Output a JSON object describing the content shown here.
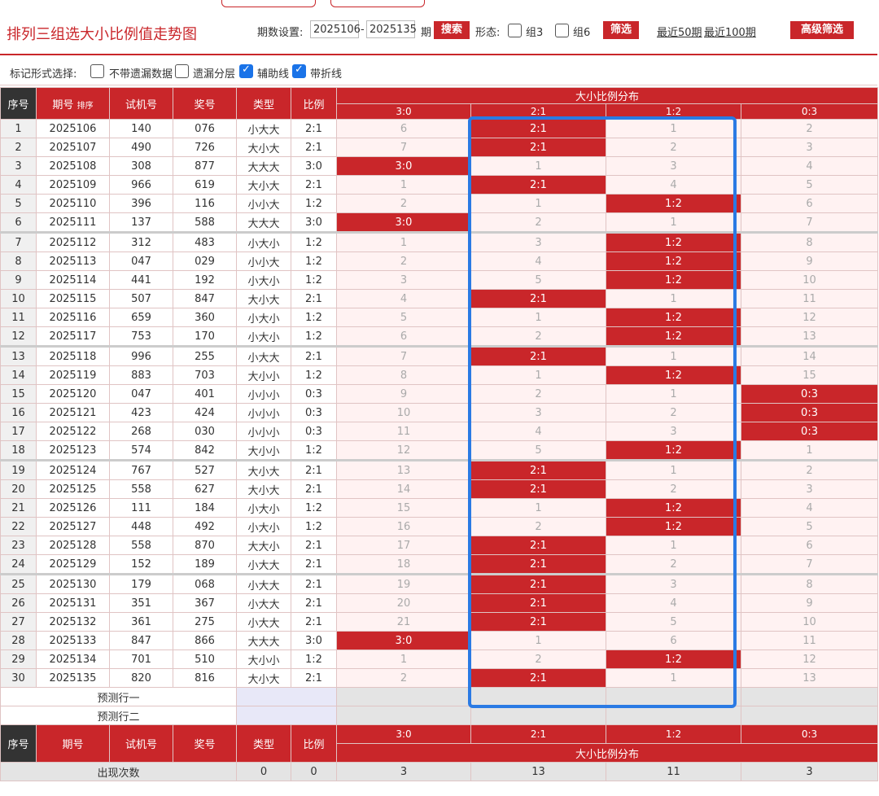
{
  "header": {
    "title": "排列三组选大小比例值走势图",
    "period_label": "期数设置:",
    "period_from": "2025106",
    "dash": "-",
    "period_to": "2025135",
    "period_unit": "期",
    "search_label": "搜索",
    "form_label": "形态:",
    "group3_label": "组3",
    "group6_label": "组6",
    "filter_label": "筛选",
    "recent50": "最近50期",
    "recent100": "最近100期",
    "advanced_label": "高级筛选"
  },
  "markrow": {
    "label": "标记形式选择:",
    "opt1": "不带遗漏数据",
    "opt2": "遗漏分层",
    "opt3": "辅助线",
    "opt4": "带折线"
  },
  "table": {
    "headers": {
      "seq": "序号",
      "period": "期号",
      "sort": "排序",
      "trial": "试机号",
      "draw": "奖号",
      "type": "类型",
      "ratio": "比例",
      "dist": "大小比例分布"
    },
    "ratio_cols": [
      "3:0",
      "2:1",
      "1:2",
      "0:3"
    ],
    "rows": [
      {
        "seq": "1",
        "period": "2025106",
        "trial": "140",
        "draw": "076",
        "type": "小大大",
        "ratio": "2:1",
        "d": [
          "6",
          "2:1",
          "1",
          "2"
        ],
        "hit": 1
      },
      {
        "seq": "2",
        "period": "2025107",
        "trial": "490",
        "draw": "726",
        "type": "大小大",
        "ratio": "2:1",
        "d": [
          "7",
          "2:1",
          "2",
          "3"
        ],
        "hit": 1
      },
      {
        "seq": "3",
        "period": "2025108",
        "trial": "308",
        "draw": "877",
        "type": "大大大",
        "ratio": "3:0",
        "d": [
          "3:0",
          "1",
          "3",
          "4"
        ],
        "hit": 0
      },
      {
        "seq": "4",
        "period": "2025109",
        "trial": "966",
        "draw": "619",
        "type": "大小大",
        "ratio": "2:1",
        "d": [
          "1",
          "2:1",
          "4",
          "5"
        ],
        "hit": 1
      },
      {
        "seq": "5",
        "period": "2025110",
        "trial": "396",
        "draw": "116",
        "type": "小小大",
        "ratio": "1:2",
        "d": [
          "2",
          "1",
          "1:2",
          "6"
        ],
        "hit": 2
      },
      {
        "seq": "6",
        "period": "2025111",
        "trial": "137",
        "draw": "588",
        "type": "大大大",
        "ratio": "3:0",
        "d": [
          "3:0",
          "2",
          "1",
          "7"
        ],
        "hit": 0
      },
      {
        "seq": "7",
        "period": "2025112",
        "trial": "312",
        "draw": "483",
        "type": "小大小",
        "ratio": "1:2",
        "d": [
          "1",
          "3",
          "1:2",
          "8"
        ],
        "hit": 2
      },
      {
        "seq": "8",
        "period": "2025113",
        "trial": "047",
        "draw": "029",
        "type": "小小大",
        "ratio": "1:2",
        "d": [
          "2",
          "4",
          "1:2",
          "9"
        ],
        "hit": 2
      },
      {
        "seq": "9",
        "period": "2025114",
        "trial": "441",
        "draw": "192",
        "type": "小大小",
        "ratio": "1:2",
        "d": [
          "3",
          "5",
          "1:2",
          "10"
        ],
        "hit": 2
      },
      {
        "seq": "10",
        "period": "2025115",
        "trial": "507",
        "draw": "847",
        "type": "大小大",
        "ratio": "2:1",
        "d": [
          "4",
          "2:1",
          "1",
          "11"
        ],
        "hit": 1
      },
      {
        "seq": "11",
        "period": "2025116",
        "trial": "659",
        "draw": "360",
        "type": "小大小",
        "ratio": "1:2",
        "d": [
          "5",
          "1",
          "1:2",
          "12"
        ],
        "hit": 2
      },
      {
        "seq": "12",
        "period": "2025117",
        "trial": "753",
        "draw": "170",
        "type": "小大小",
        "ratio": "1:2",
        "d": [
          "6",
          "2",
          "1:2",
          "13"
        ],
        "hit": 2
      },
      {
        "seq": "13",
        "period": "2025118",
        "trial": "996",
        "draw": "255",
        "type": "小大大",
        "ratio": "2:1",
        "d": [
          "7",
          "2:1",
          "1",
          "14"
        ],
        "hit": 1
      },
      {
        "seq": "14",
        "period": "2025119",
        "trial": "883",
        "draw": "703",
        "type": "大小小",
        "ratio": "1:2",
        "d": [
          "8",
          "1",
          "1:2",
          "15"
        ],
        "hit": 2
      },
      {
        "seq": "15",
        "period": "2025120",
        "trial": "047",
        "draw": "401",
        "type": "小小小",
        "ratio": "0:3",
        "d": [
          "9",
          "2",
          "1",
          "0:3"
        ],
        "hit": 3
      },
      {
        "seq": "16",
        "period": "2025121",
        "trial": "423",
        "draw": "424",
        "type": "小小小",
        "ratio": "0:3",
        "d": [
          "10",
          "3",
          "2",
          "0:3"
        ],
        "hit": 3
      },
      {
        "seq": "17",
        "period": "2025122",
        "trial": "268",
        "draw": "030",
        "type": "小小小",
        "ratio": "0:3",
        "d": [
          "11",
          "4",
          "3",
          "0:3"
        ],
        "hit": 3
      },
      {
        "seq": "18",
        "period": "2025123",
        "trial": "574",
        "draw": "842",
        "type": "大小小",
        "ratio": "1:2",
        "d": [
          "12",
          "5",
          "1:2",
          "1"
        ],
        "hit": 2
      },
      {
        "seq": "19",
        "period": "2025124",
        "trial": "767",
        "draw": "527",
        "type": "大小大",
        "ratio": "2:1",
        "d": [
          "13",
          "2:1",
          "1",
          "2"
        ],
        "hit": 1
      },
      {
        "seq": "20",
        "period": "2025125",
        "trial": "558",
        "draw": "627",
        "type": "大小大",
        "ratio": "2:1",
        "d": [
          "14",
          "2:1",
          "2",
          "3"
        ],
        "hit": 1
      },
      {
        "seq": "21",
        "period": "2025126",
        "trial": "111",
        "draw": "184",
        "type": "小大小",
        "ratio": "1:2",
        "d": [
          "15",
          "1",
          "1:2",
          "4"
        ],
        "hit": 2
      },
      {
        "seq": "22",
        "period": "2025127",
        "trial": "448",
        "draw": "492",
        "type": "小大小",
        "ratio": "1:2",
        "d": [
          "16",
          "2",
          "1:2",
          "5"
        ],
        "hit": 2
      },
      {
        "seq": "23",
        "period": "2025128",
        "trial": "558",
        "draw": "870",
        "type": "大大小",
        "ratio": "2:1",
        "d": [
          "17",
          "2:1",
          "1",
          "6"
        ],
        "hit": 1
      },
      {
        "seq": "24",
        "period": "2025129",
        "trial": "152",
        "draw": "189",
        "type": "小大大",
        "ratio": "2:1",
        "d": [
          "18",
          "2:1",
          "2",
          "7"
        ],
        "hit": 1
      },
      {
        "seq": "25",
        "period": "2025130",
        "trial": "179",
        "draw": "068",
        "type": "小大大",
        "ratio": "2:1",
        "d": [
          "19",
          "2:1",
          "3",
          "8"
        ],
        "hit": 1
      },
      {
        "seq": "26",
        "period": "2025131",
        "trial": "351",
        "draw": "367",
        "type": "小大大",
        "ratio": "2:1",
        "d": [
          "20",
          "2:1",
          "4",
          "9"
        ],
        "hit": 1
      },
      {
        "seq": "27",
        "period": "2025132",
        "trial": "361",
        "draw": "275",
        "type": "小大大",
        "ratio": "2:1",
        "d": [
          "21",
          "2:1",
          "5",
          "10"
        ],
        "hit": 1
      },
      {
        "seq": "28",
        "period": "2025133",
        "trial": "847",
        "draw": "866",
        "type": "大大大",
        "ratio": "3:0",
        "d": [
          "3:0",
          "1",
          "6",
          "11"
        ],
        "hit": 0
      },
      {
        "seq": "29",
        "period": "2025134",
        "trial": "701",
        "draw": "510",
        "type": "大小小",
        "ratio": "1:2",
        "d": [
          "1",
          "2",
          "1:2",
          "12"
        ],
        "hit": 2
      },
      {
        "seq": "30",
        "period": "2025135",
        "trial": "820",
        "draw": "816",
        "type": "大小大",
        "ratio": "2:1",
        "d": [
          "2",
          "2:1",
          "1",
          "13"
        ],
        "hit": 1
      }
    ],
    "pred1": "预测行一",
    "pred2": "预测行二",
    "stats": {
      "label": "出现次数",
      "type": "0",
      "ratio": "0",
      "values": [
        "3",
        "13",
        "11",
        "3"
      ]
    }
  }
}
